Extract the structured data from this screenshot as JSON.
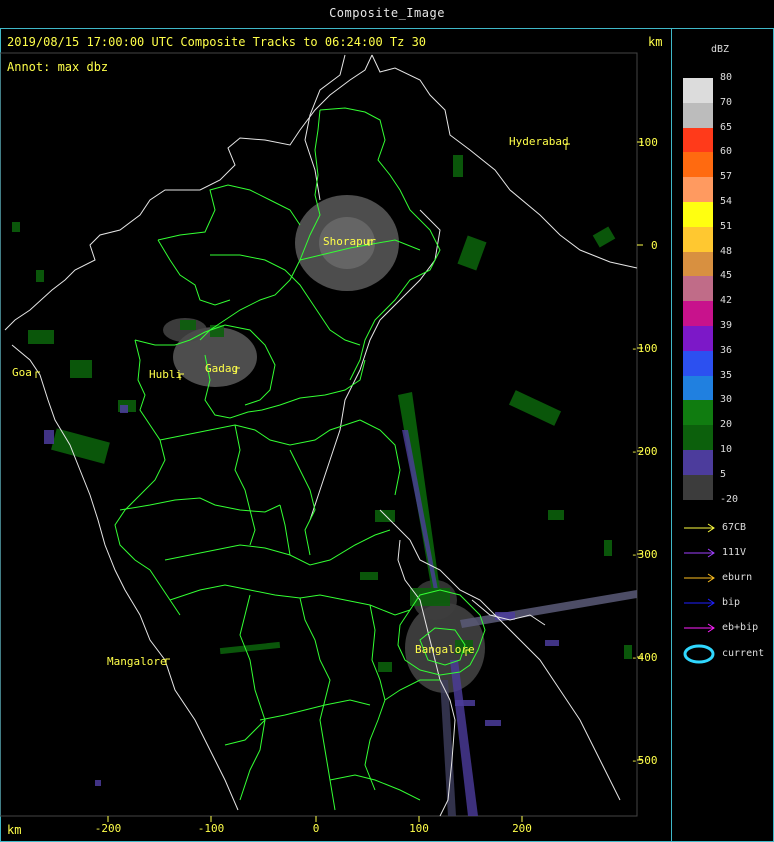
{
  "window": {
    "title": "Composite_Image"
  },
  "header": {
    "line": "2019/08/15 17:00:00 UTC Composite Tracks to 06:24:00 Tz 30",
    "annot": "Annot: max dbz",
    "km_top": "km",
    "km_bottom": "km"
  },
  "axes": {
    "x_ticks": [
      "-200",
      "-100",
      "0",
      "100",
      "200"
    ],
    "y_ticks": [
      "100",
      "0",
      "-100",
      "-200",
      "-300",
      "-400",
      "-500"
    ]
  },
  "cities": {
    "hyderabad": "Hyderabad",
    "shorapur": "Shorapur",
    "hubli": "Hubli",
    "gadag": "Gadag",
    "goa": "Goa",
    "bangalore": "Bangalore",
    "mangalore": "Mangalore"
  },
  "legend": {
    "title": "dBZ",
    "levels": [
      {
        "label": "80",
        "color": "#dcdcdc"
      },
      {
        "label": "70",
        "color": "#bcbcbc"
      },
      {
        "label": "65",
        "color": "#ff3a1a"
      },
      {
        "label": "60",
        "color": "#ff6a10"
      },
      {
        "label": "57",
        "color": "#ff9a60"
      },
      {
        "label": "54",
        "color": "#ffff10"
      },
      {
        "label": "51",
        "color": "#ffc830"
      },
      {
        "label": "48",
        "color": "#d89040"
      },
      {
        "label": "45",
        "color": "#c06c88"
      },
      {
        "label": "42",
        "color": "#c8128c"
      },
      {
        "label": "39",
        "color": "#7c18c8"
      },
      {
        "label": "36",
        "color": "#2c50f0"
      },
      {
        "label": "35",
        "color": "#2080e0"
      },
      {
        "label": "5",
        "color": "#107c10"
      },
      {
        "label": "30",
        "color": "#0c600c"
      },
      {
        "label": "20",
        "color": "#4c3c9c"
      },
      {
        "label": "10",
        "color": "#3c3c3c"
      }
    ],
    "scale_labels": [
      "80",
      "70",
      "65",
      "60",
      "57",
      "54",
      "51",
      "48",
      "45",
      "42",
      "39",
      "36",
      "35",
      "30",
      "20",
      "10",
      "5",
      "-20"
    ],
    "tracks": [
      {
        "label": "67CB",
        "color": "#ffff40"
      },
      {
        "label": "111V",
        "color": "#a040ff"
      },
      {
        "label": "eburn",
        "color": "#ffc020"
      },
      {
        "label": "bip",
        "color": "#2020ff"
      },
      {
        "label": "eb+bip",
        "color": "#ff20ff"
      },
      {
        "label": "current",
        "color": "#30d8ff"
      }
    ]
  }
}
